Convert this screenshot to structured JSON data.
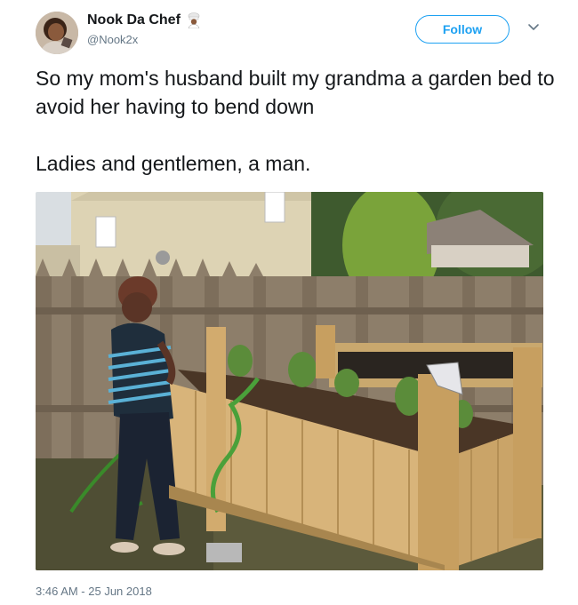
{
  "user": {
    "display_name": "Nook Da Chef",
    "handle": "@Nook2x",
    "avatar_icon": "profile-photo"
  },
  "follow": {
    "label": "Follow",
    "color": "#1da1f2"
  },
  "tweet": {
    "lines": [
      "So my mom's husband built my grandma a garden bed to avoid her having to bend down",
      "Ladies and gentlemen, a man."
    ],
    "timestamp": "3:46 AM - 25 Jun 2018"
  },
  "media": {
    "description_icon": "garden-photo"
  }
}
